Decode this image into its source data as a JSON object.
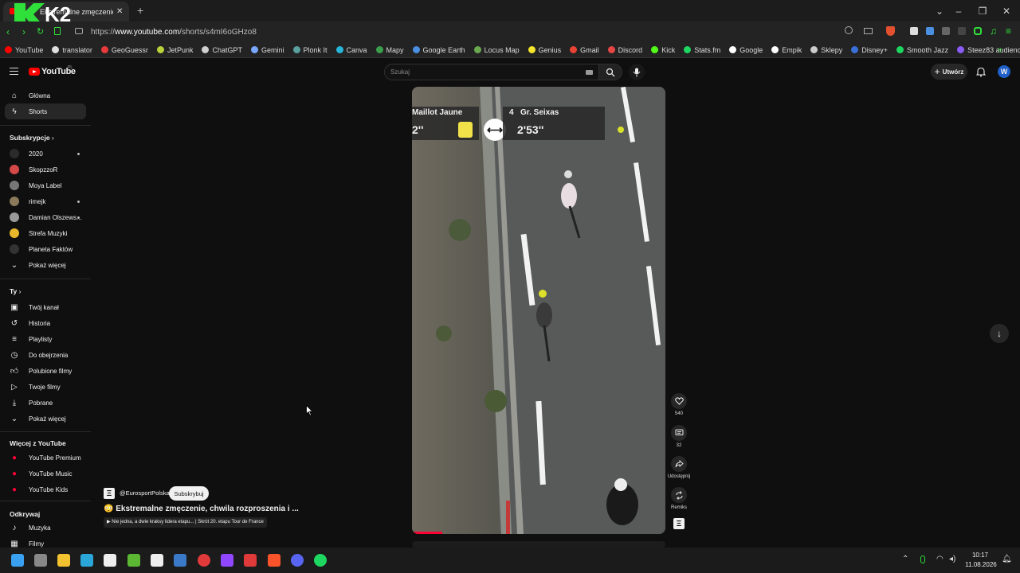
{
  "browser": {
    "tab_title": "Ekstremalne zmęczenie, c",
    "new_tab": "+",
    "url_prefix": "https://",
    "url_domain": "www.youtube.com",
    "url_path": "/shorts/s4mI6oGHzo8",
    "overlay_logo": "K2"
  },
  "bookmarks": [
    {
      "label": "YouTube",
      "color": "#ff0000"
    },
    {
      "label": "translator",
      "color": "#e0e0e0"
    },
    {
      "label": "GeoGuessr",
      "color": "#e83a3a"
    },
    {
      "label": "JetPunk",
      "color": "#b8d43a"
    },
    {
      "label": "ChatGPT",
      "color": "#d0d0d0"
    },
    {
      "label": "Gemini",
      "color": "#7aa7ff"
    },
    {
      "label": "Plonk It",
      "color": "#5aa0a0"
    },
    {
      "label": "Canva",
      "color": "#25b6d8"
    },
    {
      "label": "Mapy",
      "color": "#3b9e4a"
    },
    {
      "label": "Google Earth",
      "color": "#4a8fe0"
    },
    {
      "label": "Locus Map",
      "color": "#6aa84f"
    },
    {
      "label": "Genius",
      "color": "#f5e52b"
    },
    {
      "label": "Gmail",
      "color": "#ea4335"
    },
    {
      "label": "Discord",
      "color": "#e64545"
    },
    {
      "label": "Kick",
      "color": "#53fc18"
    },
    {
      "label": "Stats.fm",
      "color": "#1ed760"
    },
    {
      "label": "Google",
      "color": "#ffffff"
    },
    {
      "label": "Empik",
      "color": "#ffffff"
    },
    {
      "label": "Sklepy",
      "color": "#cccccc"
    },
    {
      "label": "Disney+",
      "color": "#3a6fd8"
    },
    {
      "label": "Smooth Jazz",
      "color": "#1ed760"
    },
    {
      "label": "Steez83 audiencja",
      "color": "#8a5cf5"
    }
  ],
  "header": {
    "logo": "YouTube",
    "logo_region": "PL",
    "search_placeholder": "Szukaj",
    "create_label": "Utwórz",
    "account_initial": "W"
  },
  "sidebar": {
    "main": [
      {
        "label": "Główna",
        "icon": "home-icon"
      },
      {
        "label": "Shorts",
        "icon": "shorts-icon",
        "active": true
      }
    ],
    "subs_title": "Subskrypcje",
    "subs": [
      {
        "label": "2020",
        "color": "#2b2b2b",
        "new": true
      },
      {
        "label": "SkopzzoR",
        "color": "#d44848",
        "new": false
      },
      {
        "label": "Moya Label",
        "color": "#777777",
        "new": false
      },
      {
        "label": "rimejk",
        "color": "#8a7a5a",
        "new": true
      },
      {
        "label": "Damian Olszews...",
        "color": "#999999",
        "new": true
      },
      {
        "label": "Strefa Muzyki",
        "color": "#e8b72c",
        "new": false
      },
      {
        "label": "Planeta Faktów",
        "color": "#333333",
        "new": false
      }
    ],
    "show_more": "Pokaż więcej",
    "you_title": "Ty",
    "you": [
      {
        "label": "Twój kanał",
        "icon": "channel-icon"
      },
      {
        "label": "Historia",
        "icon": "history-icon"
      },
      {
        "label": "Playlisty",
        "icon": "playlist-icon"
      },
      {
        "label": "Do obejrzenia",
        "icon": "clock-icon"
      },
      {
        "label": "Polubione filmy",
        "icon": "like-icon"
      },
      {
        "label": "Twoje filmy",
        "icon": "video-icon"
      },
      {
        "label": "Pobrane",
        "icon": "download-icon"
      },
      {
        "label": "Pokaż więcej",
        "icon": "chevron-down-icon"
      }
    ],
    "more_title": "Więcej z YouTube",
    "more": [
      {
        "label": "YouTube Premium"
      },
      {
        "label": "YouTube Music"
      },
      {
        "label": "YouTube Kids"
      }
    ],
    "explore_title": "Odkrywaj",
    "explore": [
      {
        "label": "Muzyka",
        "icon": "music-icon"
      },
      {
        "label": "Filmy",
        "icon": "film-icon"
      }
    ]
  },
  "video": {
    "scorebox_left_label": "Maillot Jaune",
    "scorebox_left_time": "2''",
    "scorebox_rank": "4",
    "scorebox_right_label": "Gr. Seixas",
    "scorebox_right_time": "2'53''",
    "progress": 0.12
  },
  "actions": {
    "likes": "540",
    "comments": "32",
    "share": "Udostępnij",
    "remix": "Remiks"
  },
  "channel": {
    "handle": "@EurosportPolska",
    "subscribe": "Subskrybuj",
    "title": "😳 Ekstremalne zmęczenie, chwila rozproszenia i ...",
    "subtitle": "▶ Nie jedna, a dwie kraksy lidera etapu... | Skrót 20. etapu Tour de France"
  },
  "taskbar": {
    "time": "10:17",
    "date": "11.08.2026"
  }
}
